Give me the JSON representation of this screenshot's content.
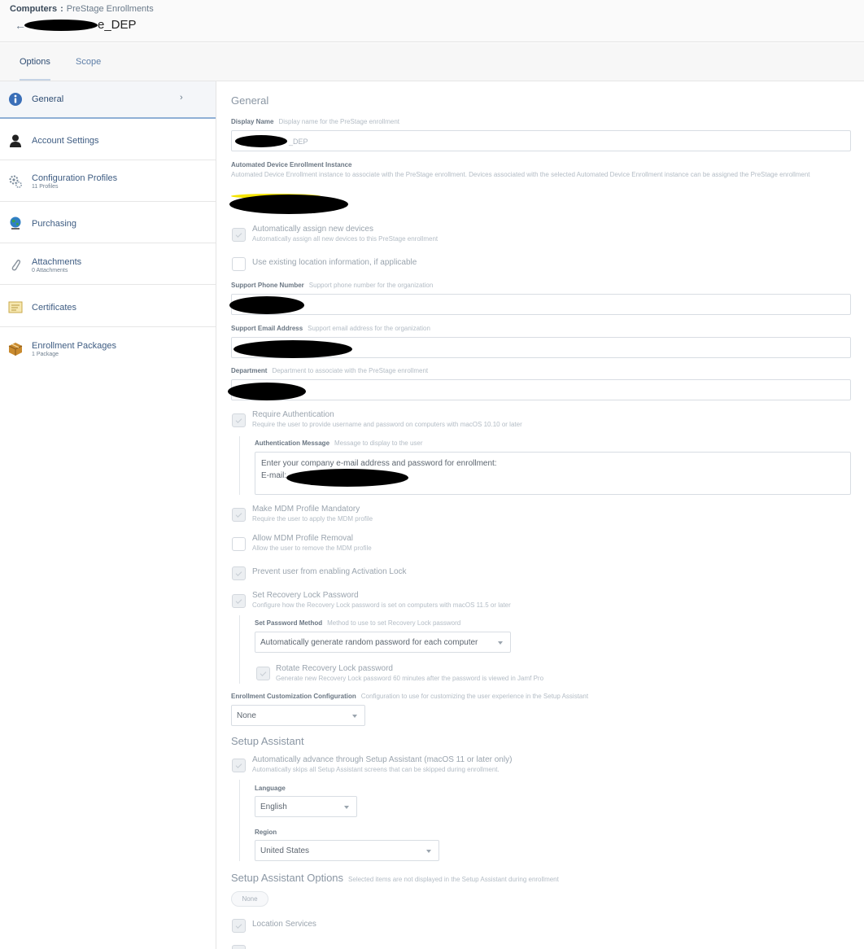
{
  "header": {
    "breadcrumb_root": "Computers",
    "breadcrumb_sep": ":",
    "breadcrumb_leaf": "PreStage Enrollments",
    "back_icon": "back-arrow-icon",
    "title_suffix": "e_DEP"
  },
  "tabs": [
    {
      "label": "Options",
      "active": true
    },
    {
      "label": "Scope",
      "active": false
    }
  ],
  "sidebar": {
    "items": [
      {
        "label": "General",
        "sub": "",
        "icon": "info-icon"
      },
      {
        "label": "Account Settings",
        "sub": "",
        "icon": "user-icon"
      },
      {
        "label": "Configuration Profiles",
        "sub": "11 Profiles",
        "icon": "gears-icon"
      },
      {
        "label": "Purchasing",
        "sub": "",
        "icon": "globe-icon"
      },
      {
        "label": "Attachments",
        "sub": "0 Attachments",
        "icon": "paperclip-icon"
      },
      {
        "label": "Certificates",
        "sub": "",
        "icon": "certificate-icon"
      },
      {
        "label": "Enrollment Packages",
        "sub": "1 Package",
        "icon": "package-icon"
      }
    ]
  },
  "general": {
    "section_title": "General",
    "display_name": {
      "label": "Display Name",
      "hint": "Display name for the PreStage enrollment",
      "value_suffix": "_DEP"
    },
    "ade_instance": {
      "label": "Automated Device Enrollment Instance",
      "hint": "Automated Device Enrollment instance to associate with the PreStage enrollment. Devices associated with the selected Automated Device Enrollment instance can be assigned the PreStage enrollment"
    },
    "auto_assign": {
      "label": "Automatically assign new devices",
      "hint": "Automatically assign all new devices to this PreStage enrollment",
      "checked": true
    },
    "existing_location": {
      "label": "Use existing location information, if applicable",
      "checked": false
    },
    "support_phone": {
      "label": "Support Phone Number",
      "hint": "Support phone number for the organization"
    },
    "support_email": {
      "label": "Support Email Address",
      "hint": "Support email address for the organization"
    },
    "department": {
      "label": "Department",
      "hint": "Department to associate with the PreStage enrollment"
    },
    "require_auth": {
      "label": "Require Authentication",
      "hint": "Require the user to provide username and password on computers with macOS 10.10 or later",
      "checked": true
    },
    "auth_message": {
      "label": "Authentication Message",
      "hint": "Message to display to the user",
      "line1": "Enter your company e-mail address and password for enrollment:",
      "line2_prefix": "E-mail:"
    },
    "mdm_mandatory": {
      "label": "Make MDM Profile Mandatory",
      "hint": "Require the user to apply the MDM profile",
      "checked": true
    },
    "mdm_removal": {
      "label": "Allow MDM Profile Removal",
      "hint": "Allow the user to remove the MDM profile",
      "checked": false
    },
    "activation_lock": {
      "label": "Prevent user from enabling Activation Lock",
      "checked": true
    },
    "recovery_lock": {
      "label": "Set Recovery Lock Password",
      "hint": "Configure how the Recovery Lock password is set on computers with macOS 11.5 or later",
      "checked": true
    },
    "password_method": {
      "label": "Set Password Method",
      "hint": "Method to use to set Recovery Lock password",
      "value": "Automatically generate random password for each computer"
    },
    "rotate_recovery": {
      "label": "Rotate Recovery Lock password",
      "hint": "Generate new Recovery Lock password 60 minutes after the password is viewed in Jamf Pro",
      "checked": true
    },
    "enrollment_customization": {
      "label": "Enrollment Customization Configuration",
      "hint": "Configuration to use for customizing the user experience in the Setup Assistant",
      "value": "None"
    }
  },
  "setup_assistant": {
    "section_title": "Setup Assistant",
    "auto_advance": {
      "label": "Automatically advance through Setup Assistant (macOS 11 or later only)",
      "hint": "Automatically skips all Setup Assistant screens that can be skipped during enrollment.",
      "checked": true
    },
    "language": {
      "label": "Language",
      "value": "English"
    },
    "region": {
      "label": "Region",
      "value": "United States"
    }
  },
  "setup_options": {
    "section_title": "Setup Assistant Options",
    "hint": "Selected items are not displayed in the Setup Assistant during enrollment",
    "pill": "None",
    "location_services": {
      "label": "Location Services",
      "checked": true
    }
  },
  "colors": {
    "accent": "#3e5c82",
    "active_border": "#8fb0d6",
    "redaction": "#000000",
    "highlight": "#f5e400"
  }
}
